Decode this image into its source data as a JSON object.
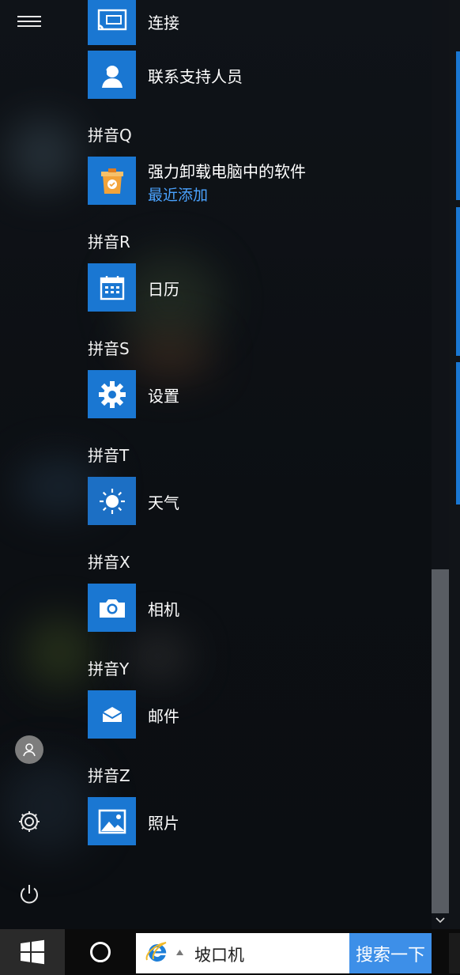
{
  "start_menu": {
    "groups": [
      {
        "header": "",
        "apps": [
          {
            "label": "连接",
            "icon": "cast-icon"
          },
          {
            "label": "联系支持人员",
            "icon": "support-agent-icon"
          }
        ]
      },
      {
        "header": "拼音Q",
        "apps": [
          {
            "label": "强力卸载电脑中的软件",
            "sublabel": "最近添加",
            "icon": "uninstall-box-icon"
          }
        ]
      },
      {
        "header": "拼音R",
        "apps": [
          {
            "label": "日历",
            "icon": "calendar-icon"
          }
        ]
      },
      {
        "header": "拼音S",
        "apps": [
          {
            "label": "设置",
            "icon": "gear-icon"
          }
        ]
      },
      {
        "header": "拼音T",
        "apps": [
          {
            "label": "天气",
            "icon": "sun-icon"
          }
        ]
      },
      {
        "header": "拼音X",
        "apps": [
          {
            "label": "相机",
            "icon": "camera-icon"
          }
        ]
      },
      {
        "header": "拼音Y",
        "apps": [
          {
            "label": "邮件",
            "icon": "mail-icon"
          }
        ]
      },
      {
        "header": "拼音Z",
        "apps": [
          {
            "label": "照片",
            "icon": "photo-icon"
          }
        ]
      }
    ]
  },
  "left_rail": {
    "icons": [
      "hamburger-menu-icon",
      "user-avatar-icon",
      "settings-gear-icon",
      "power-icon"
    ]
  },
  "taskbar": {
    "search_text": "坡口机",
    "search_button_label": "搜索一下",
    "icons": [
      "windows-logo-icon",
      "cortana-circle-icon",
      "ie-browser-icon"
    ]
  },
  "colors": {
    "accent": "#1a77d2",
    "link": "#4aa3ff",
    "background": "#0d1014",
    "search_button": "#3d8fe8"
  }
}
